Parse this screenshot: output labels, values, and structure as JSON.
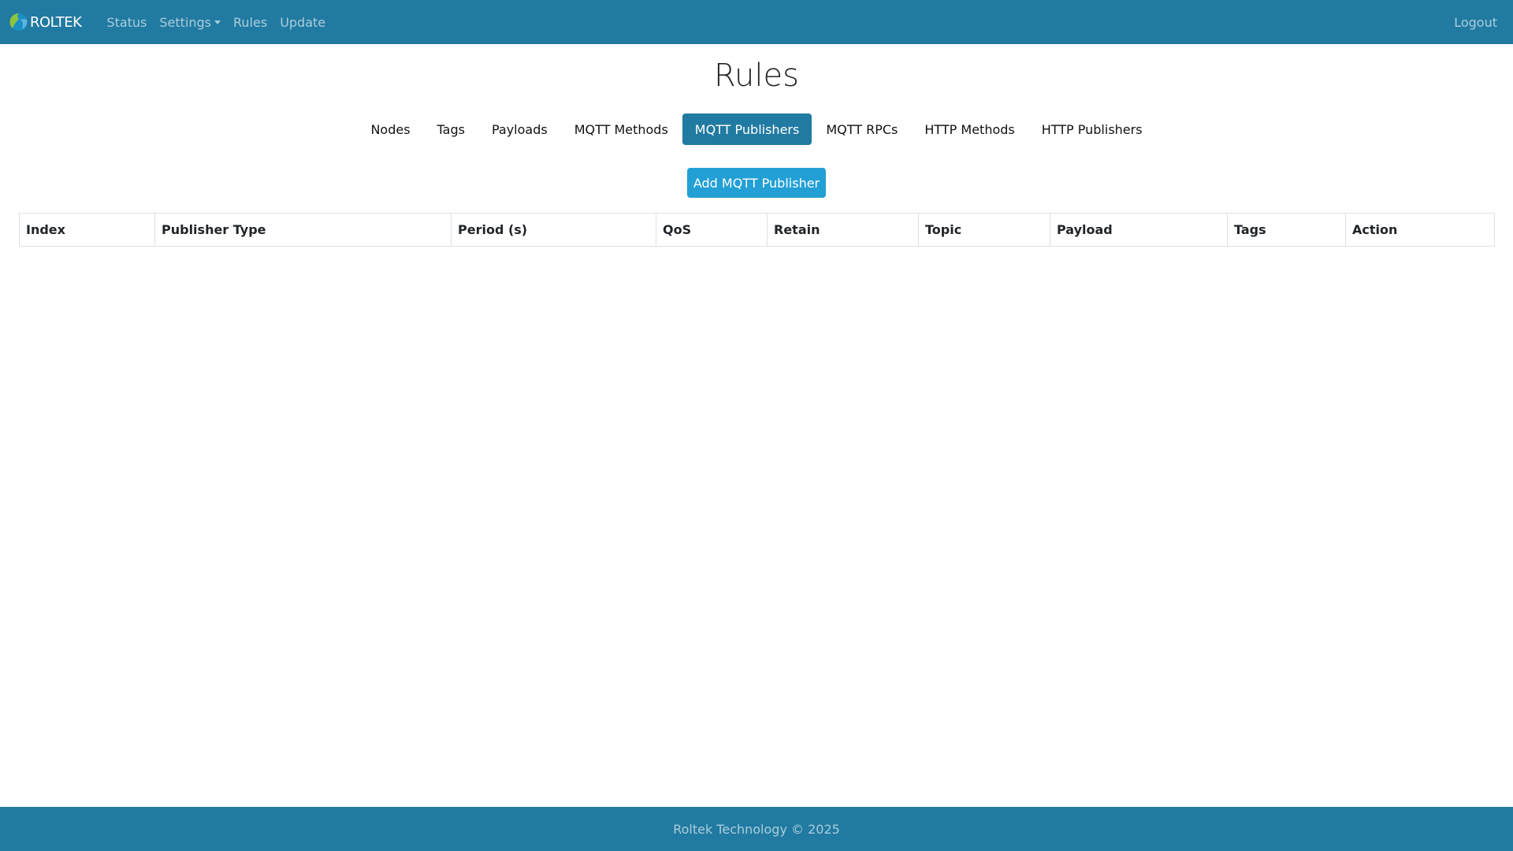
{
  "navbar": {
    "brand": "ROLTEK",
    "logo_icon": "globe-logo-icon",
    "links": [
      {
        "label": "Status"
      },
      {
        "label": "Settings",
        "dropdown": true
      },
      {
        "label": "Rules"
      },
      {
        "label": "Update"
      }
    ],
    "logout_label": "Logout"
  },
  "page": {
    "title": "Rules"
  },
  "tabs": [
    {
      "label": "Nodes",
      "active": false
    },
    {
      "label": "Tags",
      "active": false
    },
    {
      "label": "Payloads",
      "active": false
    },
    {
      "label": "MQTT Methods",
      "active": false
    },
    {
      "label": "MQTT Publishers",
      "active": true
    },
    {
      "label": "MQTT RPCs",
      "active": false
    },
    {
      "label": "HTTP Methods",
      "active": false
    },
    {
      "label": "HTTP Publishers",
      "active": false
    }
  ],
  "actions": {
    "add_label": "Add MQTT Publisher"
  },
  "table": {
    "columns": [
      "Index",
      "Publisher Type",
      "Period (s)",
      "QoS",
      "Retain",
      "Topic",
      "Payload",
      "Tags",
      "Action"
    ],
    "rows": []
  },
  "footer": {
    "text": "Roltek Technology © 2025"
  },
  "colors": {
    "navbar_bg": "#217aa1",
    "active_tab_bg": "#217aa1",
    "add_button_bg": "#22a0d6"
  }
}
